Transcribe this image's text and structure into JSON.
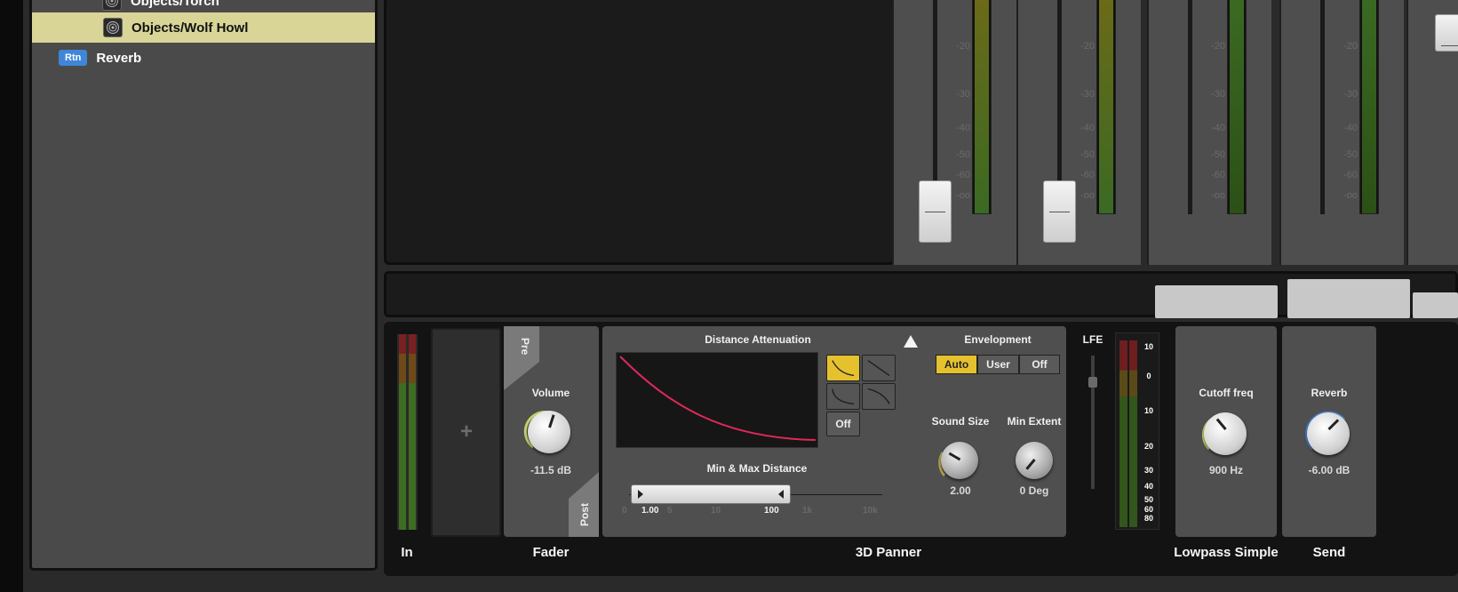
{
  "browser": {
    "items": [
      {
        "label": "Objects/Torch",
        "type": "event",
        "selected": false
      },
      {
        "label": "Objects/Wolf Howl",
        "type": "event",
        "selected": true
      },
      {
        "label": "Reverb",
        "type": "return",
        "badge": "Rtn",
        "selected": false
      }
    ]
  },
  "mixer_strips": {
    "scale_labels": [
      "-20",
      "-30",
      "-40",
      "-50",
      "-60",
      "-oo"
    ]
  },
  "deck": {
    "in_label": "In",
    "add_effect_glyph": "+",
    "fader": {
      "pre_label": "Pre",
      "post_label": "Post",
      "volume_label": "Volume",
      "volume_value": "-11.5 dB",
      "title": "Fader"
    },
    "panner": {
      "title": "3D Panner",
      "distance_attenuation_label": "Distance Attenuation",
      "off_label": "Off",
      "min_max_label": "Min & Max Distance",
      "ruler_labels": [
        "0",
        "1.00",
        "5",
        "10",
        "100",
        "1k",
        "10k"
      ],
      "envelopment_label": "Envelopment",
      "envelopment_options": [
        "Auto",
        "User",
        "Off"
      ],
      "envelopment_selected": "Auto",
      "sound_size_label": "Sound Size",
      "sound_size_value": "2.00",
      "min_extent_label": "Min Extent",
      "min_extent_value": "0 Deg",
      "lfe_label": "LFE",
      "meter_scale": [
        "10",
        "0",
        "10",
        "20",
        "30",
        "40",
        "50",
        "60",
        "80"
      ]
    },
    "lowpass": {
      "title": "Lowpass Simple",
      "param_label": "Cutoff freq",
      "value": "900 Hz"
    },
    "send": {
      "title": "Send",
      "param_label": "Reverb",
      "value": "-6.00 dB"
    }
  },
  "colors": {
    "selection": "#d8d597",
    "accent_yellow": "#e6c12e",
    "curve": "#e0285a",
    "rtn_badge": "#3f86d8",
    "send_knob_ring": "#4a7fd0",
    "fader_knob_ring": "#c9d36a"
  }
}
